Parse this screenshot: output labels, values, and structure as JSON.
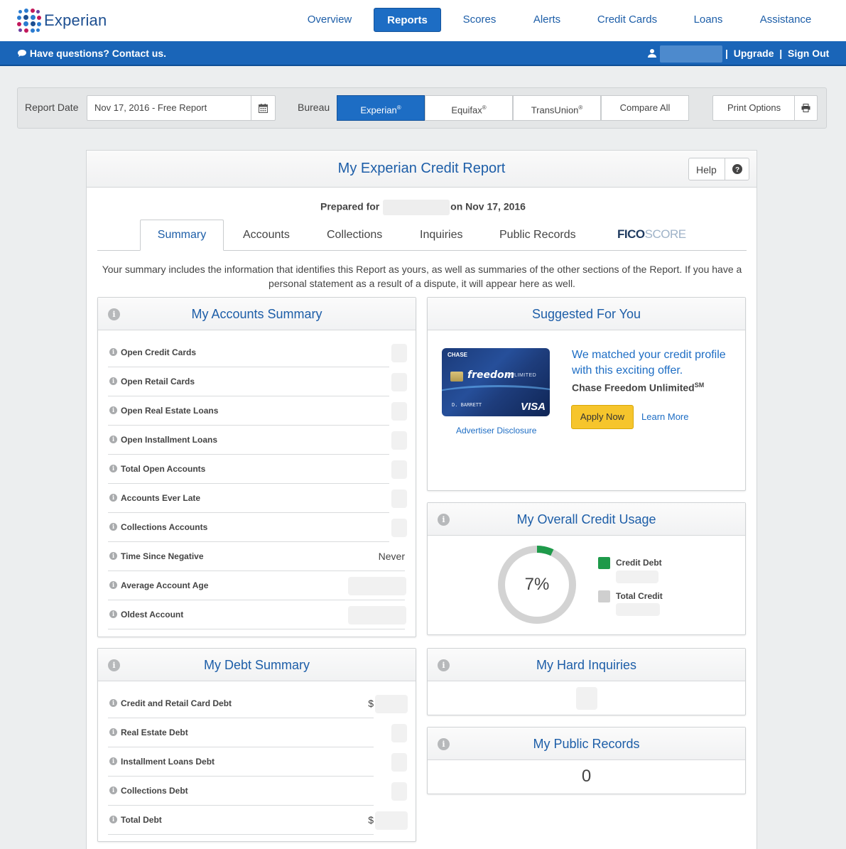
{
  "header": {
    "brand": "Experian",
    "nav": [
      {
        "label": "Overview"
      },
      {
        "label": "Reports"
      },
      {
        "label": "Scores"
      },
      {
        "label": "Alerts"
      },
      {
        "label": "Credit Cards"
      },
      {
        "label": "Loans"
      },
      {
        "label": "Assistance"
      }
    ],
    "active_nav": "Reports"
  },
  "bluebar": {
    "contact": "Have questions? Contact us.",
    "upgrade": "Upgrade",
    "sign_out": "Sign Out",
    "separator": "|"
  },
  "toolbar": {
    "report_date_label": "Report Date",
    "report_date_value": "Nov 17, 2016 - Free Report",
    "bureau_label": "Bureau",
    "bureaus": [
      "Experian",
      "Equifax",
      "TransUnion"
    ],
    "registered": "®",
    "compare_all": "Compare All",
    "print_options": "Print Options"
  },
  "report": {
    "title": "My Experian Credit Report",
    "help": "Help",
    "prepared_for": "Prepared for",
    "prepared_on": "on Nov 17, 2016",
    "tabs": [
      "Summary",
      "Accounts",
      "Collections",
      "Inquiries",
      "Public Records"
    ],
    "fico_a": "FICO",
    "fico_b": "SCORE",
    "intro": "Your summary includes the information that identifies this Report as yours, as well as summaries of the other sections of the Report. If you have a personal statement as a result of a dispute, it will appear here as well."
  },
  "accounts_summary": {
    "title": "My Accounts Summary",
    "rows": [
      {
        "label": "Open Credit Cards",
        "value": ""
      },
      {
        "label": "Open Retail Cards",
        "value": ""
      },
      {
        "label": "Open Real Estate Loans",
        "value": ""
      },
      {
        "label": "Open Installment Loans",
        "value": ""
      },
      {
        "label": "Total Open Accounts",
        "value": ""
      },
      {
        "label": "Accounts Ever Late",
        "value": ""
      },
      {
        "label": "Collections Accounts",
        "value": ""
      },
      {
        "label": "Time Since Negative",
        "value": "Never"
      },
      {
        "label": "Average Account Age",
        "value": ""
      },
      {
        "label": "Oldest Account",
        "value": ""
      }
    ]
  },
  "debt_summary": {
    "title": "My Debt Summary",
    "rows": [
      {
        "label": "Credit and Retail Card Debt",
        "value": "$"
      },
      {
        "label": "Real Estate Debt",
        "value": ""
      },
      {
        "label": "Installment Loans Debt",
        "value": ""
      },
      {
        "label": "Collections Debt",
        "value": ""
      },
      {
        "label": "Total Debt",
        "value": "$"
      }
    ]
  },
  "suggested": {
    "title": "Suggested For You",
    "headline": "We matched your credit profile with this exciting offer.",
    "product": "Chase Freedom Unlimited",
    "product_mark": "SM",
    "apply": "Apply Now",
    "learn_more": "Learn More",
    "advertiser_disclosure": "Advertiser Disclosure",
    "card": {
      "issuer": "CHASE",
      "brand": "freedom",
      "tier": "UNLIMITED",
      "cardholder": "D. BARRETT",
      "network": "VISA"
    }
  },
  "credit_usage": {
    "title": "My Overall Credit Usage",
    "percent_label": "7%",
    "utilization": 0.07,
    "legend": [
      {
        "label": "Credit Debt",
        "color": "#1e9a4a"
      },
      {
        "label": "Total Credit",
        "color": "#cfcfcf"
      }
    ]
  },
  "hard_inquiries": {
    "title": "My Hard Inquiries"
  },
  "public_records": {
    "title": "My Public Records",
    "count": "0"
  },
  "colors": {
    "brand_blue": "#1d5ea8",
    "nav_active": "#1d6dc4",
    "bar_blue": "#1a65b8",
    "apply_yellow": "#f6c52c"
  }
}
